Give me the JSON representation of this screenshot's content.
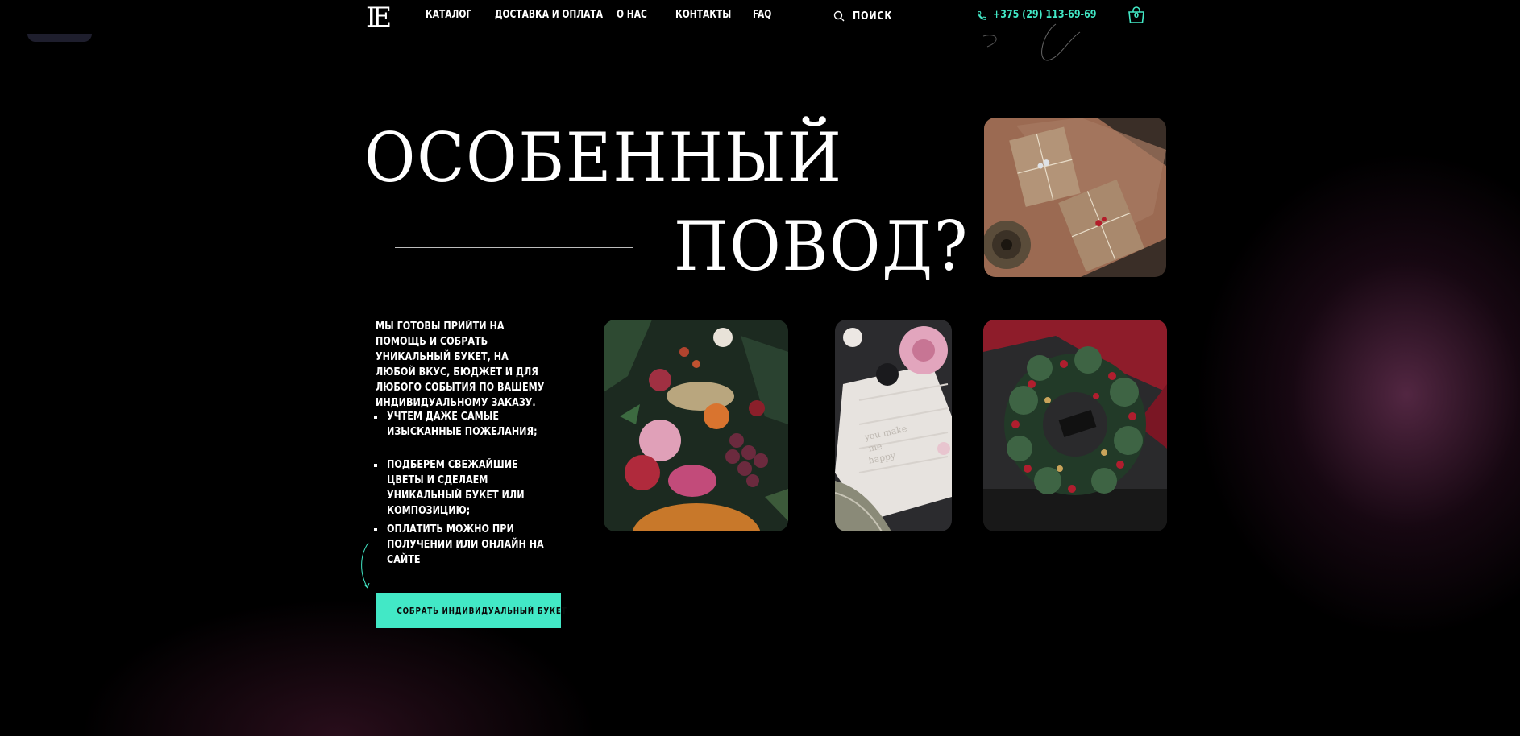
{
  "header": {
    "logo_text": "IE",
    "nav": [
      "КАТАЛОГ",
      "ДОСТАВКА И ОПЛАТА",
      "О НАС",
      "КОНТАКТЫ",
      "FAQ"
    ],
    "search_label": "ПОИСК",
    "phone": "+375 (29) 113-69-69",
    "cart_count": "0"
  },
  "hero": {
    "headline_line1": "ОСОБЕННЫЙ",
    "headline_line2": "ПОВОД?",
    "intro": "МЫ ГОТОВЫ ПРИЙТИ НА ПОМОЩЬ И СОБРАТЬ УНИКАЛЬНЫЙ БУКЕТ, НА ЛЮБОЙ ВКУС, БЮДЖЕТ И ДЛЯ ЛЮБОГО СОБЫТИЯ ПО ВАШЕМУ ИНДИВИДУАЛЬНОМУ ЗАКАЗУ.",
    "bullets": [
      "УЧТЕМ ДАЖЕ САМЫЕ ИЗЫСКАННЫЕ ПОЖЕЛАНИЯ;",
      "ПОДБЕРЕМ СВЕЖАЙШИЕ ЦВЕТЫ И СДЕЛАЕМ УНИКАЛЬНЫЙ БУКЕТ ИЛИ КОМПОЗИЦИЮ;",
      "ОПЛАТИТЬ МОЖНО ПРИ ПОЛУЧЕНИИ ИЛИ ОНЛАЙН НА САЙТЕ"
    ],
    "cta_label": "СОБРАТЬ ИНДИВИДУАЛЬНЫЙ БУКЕТ"
  },
  "photos": [
    {
      "name": "gift-boxes-photo",
      "subject": "kraft paper gift boxes with twine"
    },
    {
      "name": "fruit-bouquet-photo",
      "subject": "bouquet with flowers, grapes and fruit"
    },
    {
      "name": "card-flowers-photo",
      "subject": "greeting card with pink flowers and ribbon"
    },
    {
      "name": "christmas-wreath-photo",
      "subject": "christmas wreath on red fabric"
    }
  ],
  "colors": {
    "accent": "#42e8c6",
    "background": "#000000",
    "glow": "#8a3f72"
  },
  "icons": {
    "search": "search-icon",
    "phone": "phone-icon",
    "cart": "shopping-bag-icon"
  }
}
